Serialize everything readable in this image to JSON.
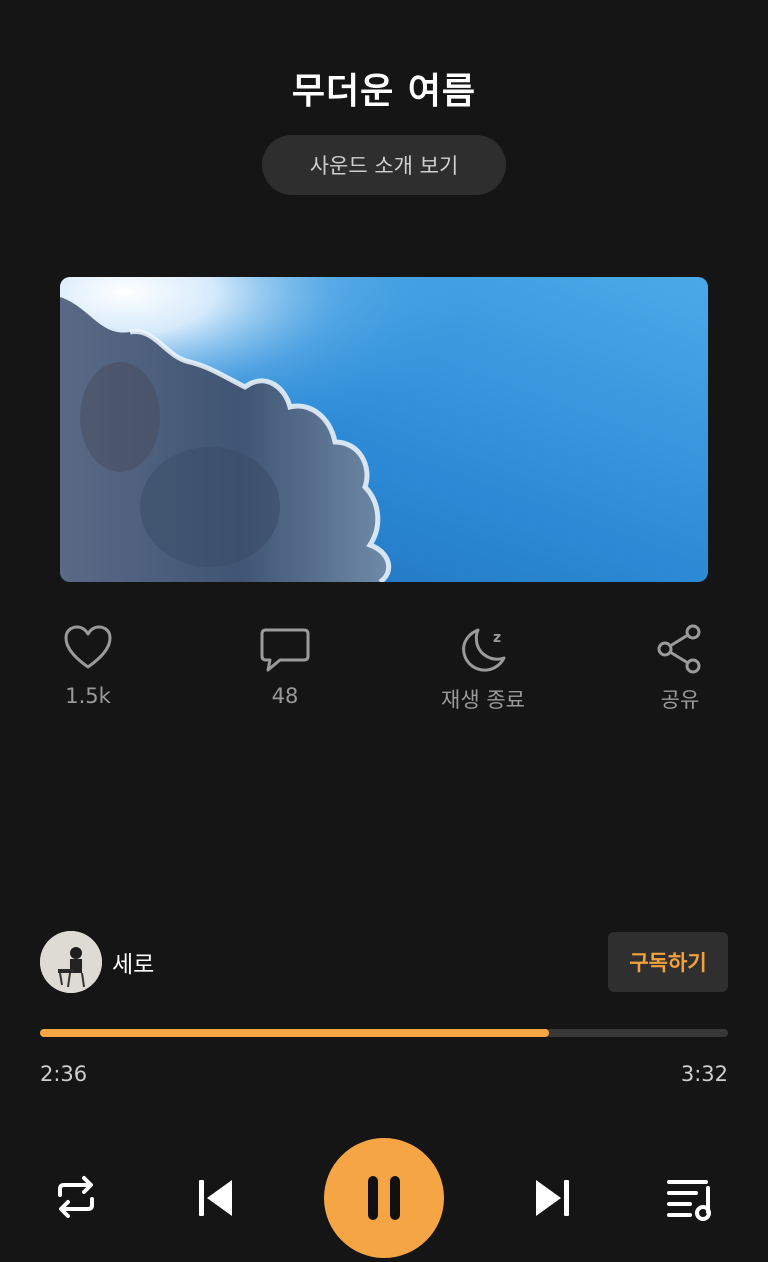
{
  "track": {
    "title": "무더운 여름",
    "intro_button": "사운드 소개 보기"
  },
  "actions": {
    "like": {
      "icon": "heart-icon",
      "label": "1.5k"
    },
    "comment": {
      "icon": "comment-icon",
      "label": "48"
    },
    "sleep": {
      "icon": "moon-icon",
      "label": "재생 종료"
    },
    "share": {
      "icon": "share-icon",
      "label": "공유"
    }
  },
  "artist": {
    "name": "세로",
    "subscribe_label": "구독하기"
  },
  "player": {
    "elapsed": "2:36",
    "total": "3:32",
    "progress_fraction": 0.74,
    "state": "playing"
  },
  "controls": {
    "repeat": "repeat-icon",
    "previous": "skip-previous-icon",
    "pause": "pause-icon",
    "next": "skip-next-icon",
    "playlist": "playlist-icon"
  },
  "colors": {
    "background": "#151515",
    "accent": "#f5a544",
    "muted_text": "#9a9a9a"
  }
}
